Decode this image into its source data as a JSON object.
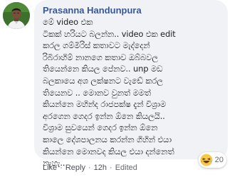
{
  "comment": {
    "author": "Prasanna Handunpura",
    "text": "මේ video එක\nටිකක් හරියට බලන්න.. video එක edit\nකරල ගම්මිරිස් කතාවට මැද්දෙන්\nරිබිරාහිම් නානගෙ කතාව ඔබ්බවල\nතියෙන්නෙ කියල පේනව.. unp මඩ\nබලකායෙ අශ ලක්ෂනට වැඩේ කරල\nතියෙනව .. මොනව වුනත් මමත්\nකියන්නෙ මහින්ද රාජපක්ෂ දැන් විශ්‍රාම\nඅරගෙන ගෙදර ඉන්න ඕනෙ කියලයි..\nවිශ්‍රාම සුවයෙන් ගෙදර ඉන්න ඕනෙ\nකාලෙ දේශපාලනය කරන්න ගිහින් එයා\nකියන්නෙ මොනවද කියල එයා දන්නෙත්\nනැහැ..",
    "reaction_count": "20",
    "reaction_icon": "laughing-face-icon"
  },
  "actions": {
    "like": "Like",
    "reply": "Reply",
    "time": "12h",
    "edited": "Edited",
    "separator": "·"
  },
  "colors": {
    "author": "#385898",
    "bubble": "#f0f2f5",
    "meta": "#65676b"
  }
}
